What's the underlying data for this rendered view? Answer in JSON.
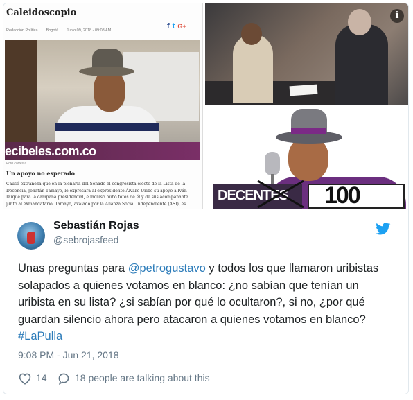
{
  "images": {
    "clipping": {
      "masthead": "Caleidoscopio",
      "meta": [
        "Redacción Política",
        "Bogotá",
        "Junio 09, 2018 - 09:08 AM"
      ],
      "share": {
        "facebook": "f",
        "twitter": "t",
        "gplus": "G+"
      },
      "banner_text": "ecibeles.com.co",
      "caption": "Foto cortesía",
      "subhead": "Un apoyo no esperado",
      "body": "Causó extrañeza que en la plenaria del Senado el congresista electo de la Lista de la Decencia, Jonatán Tamayo, le expresara al expresidente Álvaro Uribe su apoyo a Iván Duque para la campaña presidencial, e incluso hubo fotos de él y de sus acompañante junto al exmandatario. Tamayo, avalado por la Alianza Social Independiente (ASI), es"
    },
    "senate_photo": {
      "info_glyph": "i"
    },
    "poster": {
      "decentes_text": "DECENTES",
      "number_text": "100"
    }
  },
  "tweet": {
    "author_name": "Sebastián Rojas",
    "author_handle": "@sebrojasfeed",
    "text_before": "Unas preguntas para ",
    "mention": "@petrogustavo",
    "text_after": " y todos los que llamaron uribistas solapados a quienes votamos en blanco: ¿no sabían que tenían un uribista en su lista? ¿si sabían por qué lo ocultaron?, si no, ¿por qué guardan silencio ahora pero atacaron a quienes votamos en blanco? ",
    "hashtag": "#LaPulla",
    "timestamp": "9:08 PM - Jun 21, 2018",
    "likes": "14",
    "talking": "18 people are talking about this"
  },
  "colors": {
    "link": "#2b7bb9",
    "twitter_blue": "#1da1f2",
    "muted": "#657786"
  },
  "icons": [
    "info-icon",
    "twitter-bird-icon",
    "heart-icon",
    "reply-bubble-icon"
  ]
}
